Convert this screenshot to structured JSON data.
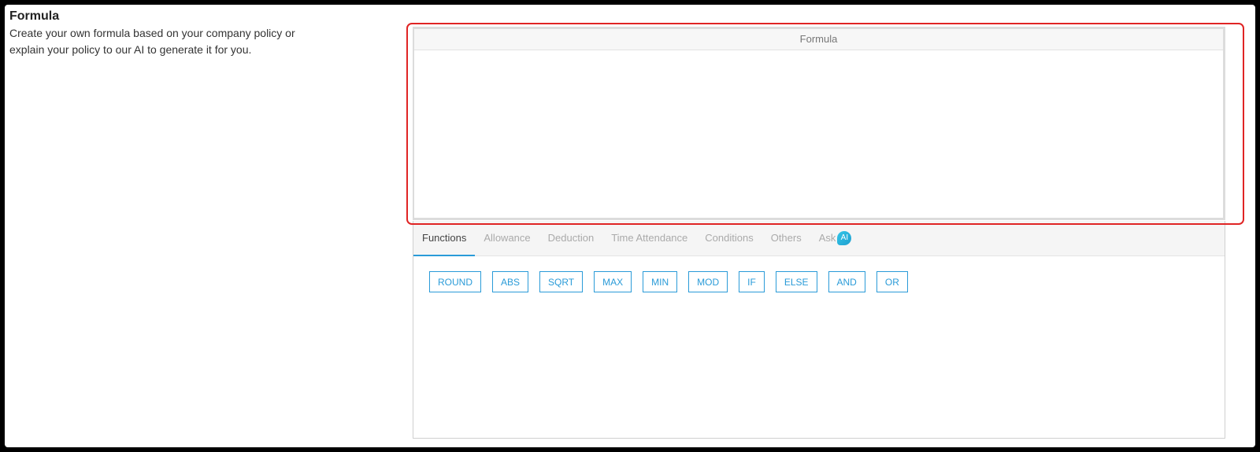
{
  "section": {
    "title": "Formula",
    "description": "Create your own formula based on your company policy or explain your policy to our AI to generate it for you."
  },
  "formula": {
    "header": "Formula",
    "value": ""
  },
  "tabs": [
    {
      "label": "Functions",
      "active": true
    },
    {
      "label": "Allowance",
      "active": false
    },
    {
      "label": "Deduction",
      "active": false
    },
    {
      "label": "Time Attendance",
      "active": false
    },
    {
      "label": "Conditions",
      "active": false
    },
    {
      "label": "Others",
      "active": false
    },
    {
      "label": "Ask",
      "active": false,
      "badge": "AI"
    }
  ],
  "functions": [
    "ROUND",
    "ABS",
    "SQRT",
    "MAX",
    "MIN",
    "MOD",
    "IF",
    "ELSE",
    "AND",
    "OR"
  ],
  "colors": {
    "accent": "#2a9bd8",
    "highlight": "#e02424",
    "ai_badge": "#34c6e8"
  }
}
